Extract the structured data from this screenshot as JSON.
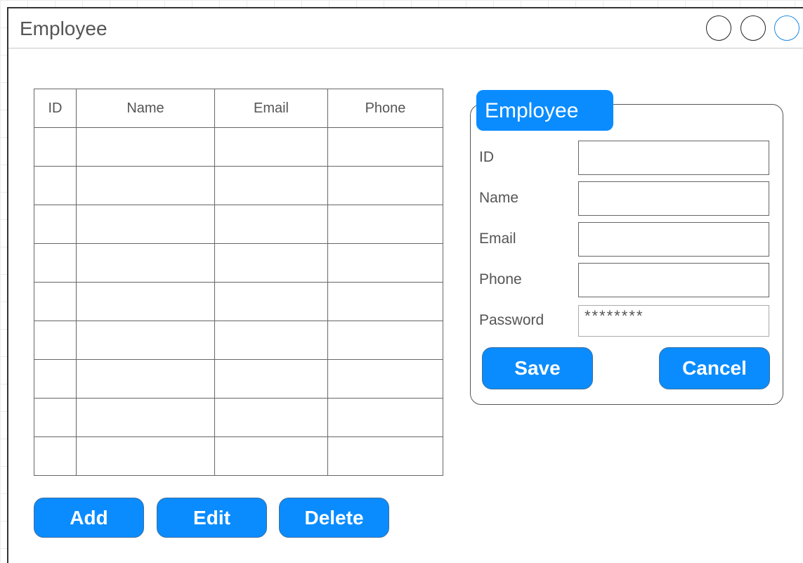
{
  "window": {
    "title": "Employee"
  },
  "table": {
    "headers": [
      "ID",
      "Name",
      "Email",
      "Phone"
    ]
  },
  "actions": {
    "add": "Add",
    "edit": "Edit",
    "delete": "Delete"
  },
  "form": {
    "title": "Employee",
    "fields": [
      {
        "label": "ID",
        "value": ""
      },
      {
        "label": "Name",
        "value": ""
      },
      {
        "label": "Email",
        "value": ""
      },
      {
        "label": "Phone",
        "value": ""
      },
      {
        "label": "Password",
        "value": "********"
      }
    ],
    "save": "Save",
    "cancel": "Cancel"
  },
  "colors": {
    "accent": "#0a8cff",
    "border": "#666666",
    "text": "#555555"
  }
}
